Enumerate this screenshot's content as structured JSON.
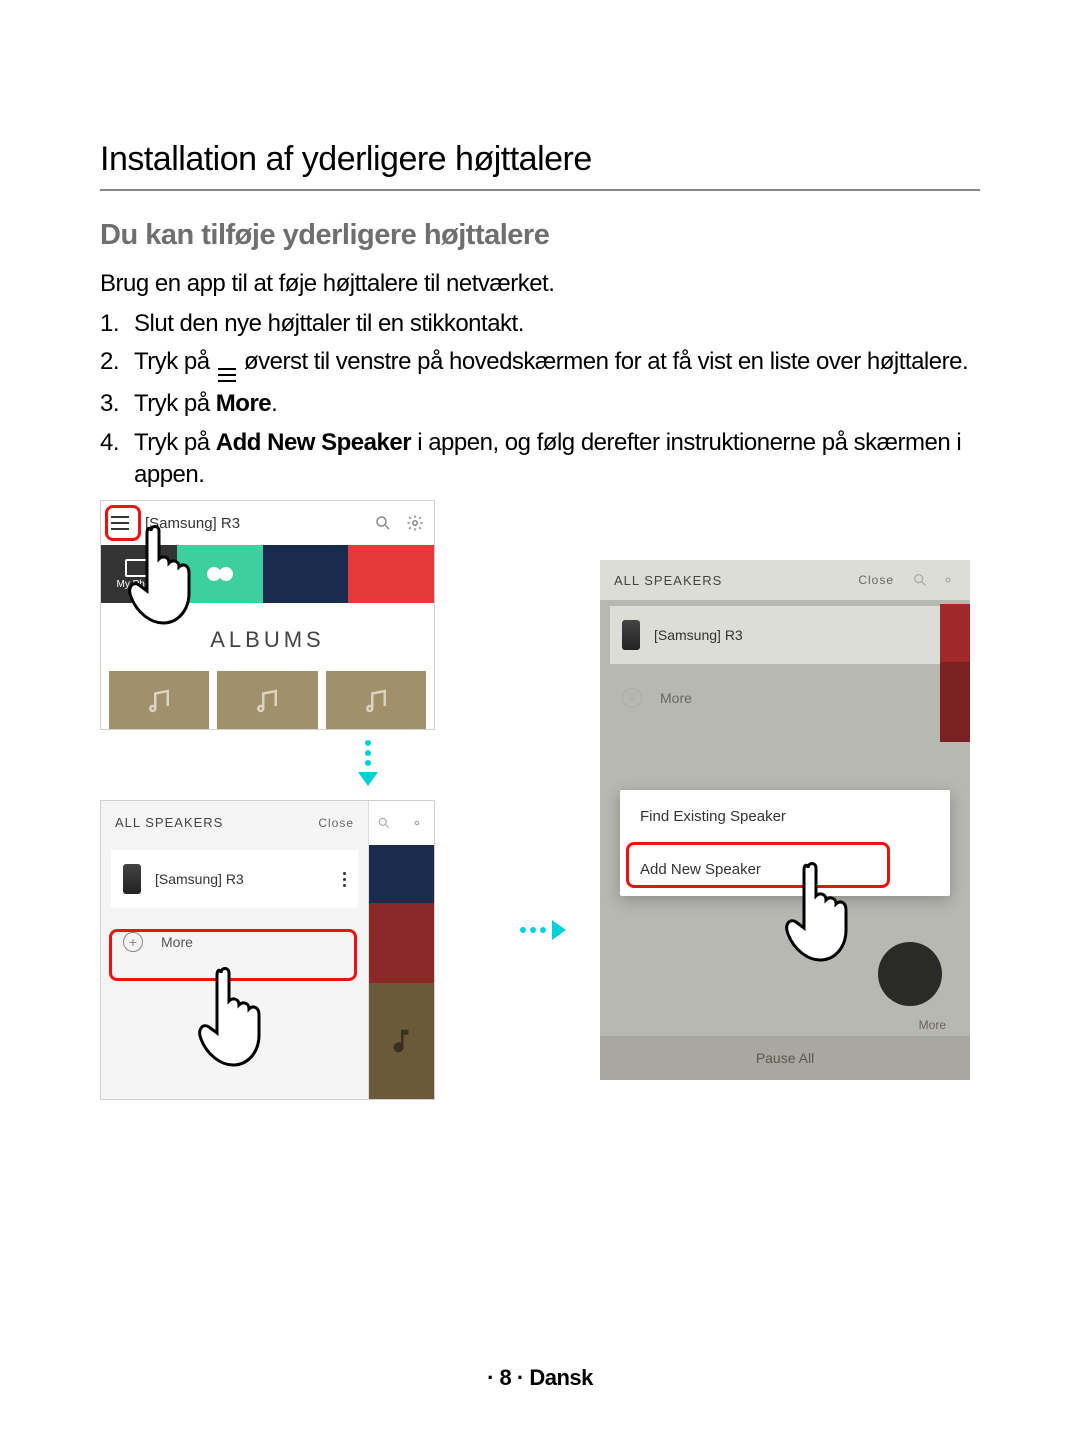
{
  "page": {
    "title": "Installation af yderligere højttalere",
    "subtitle": "Du kan tilføje yderligere højttalere",
    "intro": "Brug en app til at føje højttalere til netværket.",
    "footer": "· 8 · Dansk"
  },
  "steps": {
    "s1": "Slut den nye højttaler til en stikkontakt.",
    "s2a": "Tryk på ",
    "s2b": " øverst til venstre på hovedskærmen for at få vist en liste over højttalere.",
    "s3a": "Tryk på ",
    "s3b": "More",
    "s3c": ".",
    "s4a": "Tryk på ",
    "s4b": "Add New Speaker",
    "s4c": " i appen, og følg derefter instruktionerne på skærmen i appen."
  },
  "screen1": {
    "title": "[Samsung] R3",
    "my_phone": "My Phone",
    "albums": "ALBUMS"
  },
  "drawer": {
    "header": "ALL SPEAKERS",
    "close": "Close",
    "speaker": "[Samsung] R3",
    "more": "More"
  },
  "screen3": {
    "header": "ALL SPEAKERS",
    "close": "Close",
    "speaker": "[Samsung] R3",
    "more": "More",
    "opt1": "Find Existing Speaker",
    "opt2": "Add New Speaker",
    "bottom_more": "More",
    "pause": "Pause All"
  }
}
